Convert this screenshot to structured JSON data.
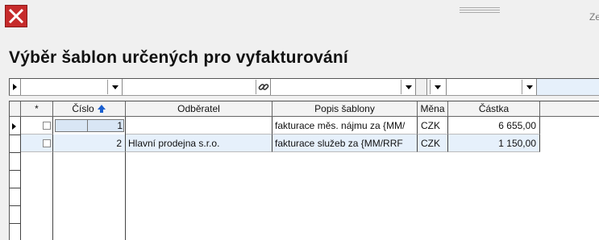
{
  "window": {
    "close_icon": "close-icon",
    "corner_text": "Ze"
  },
  "title": "Výběr šablon určených pro vyfakturování",
  "filter_bar": {
    "values": [
      "",
      "",
      "",
      "",
      ""
    ],
    "link_icon": "paperclip-icon",
    "dropdown_icon": "chevron-down-icon"
  },
  "table": {
    "columns": [
      "*",
      "Číslo",
      "Odběratel",
      "Popis šablony",
      "Měna",
      "Částka"
    ],
    "sort_icon": "sort-up-arrow-icon",
    "rows": [
      {
        "cislo": "1",
        "odberatel": "",
        "popis": "fakturace měs. nájmu za {MM/",
        "mena": "CZK",
        "castka": "6 655,00",
        "checked": false
      },
      {
        "cislo": "2",
        "odberatel": "Hlavní prodejna s.r.o.",
        "popis": "fakturace služeb za {MM/RRF",
        "mena": "CZK",
        "castka": "1 150,00",
        "checked": false
      }
    ]
  },
  "colors": {
    "selected_row": "#e6f0fb",
    "sort_arrow": "#1a5fd0",
    "close_bg": "#c62b2b"
  }
}
